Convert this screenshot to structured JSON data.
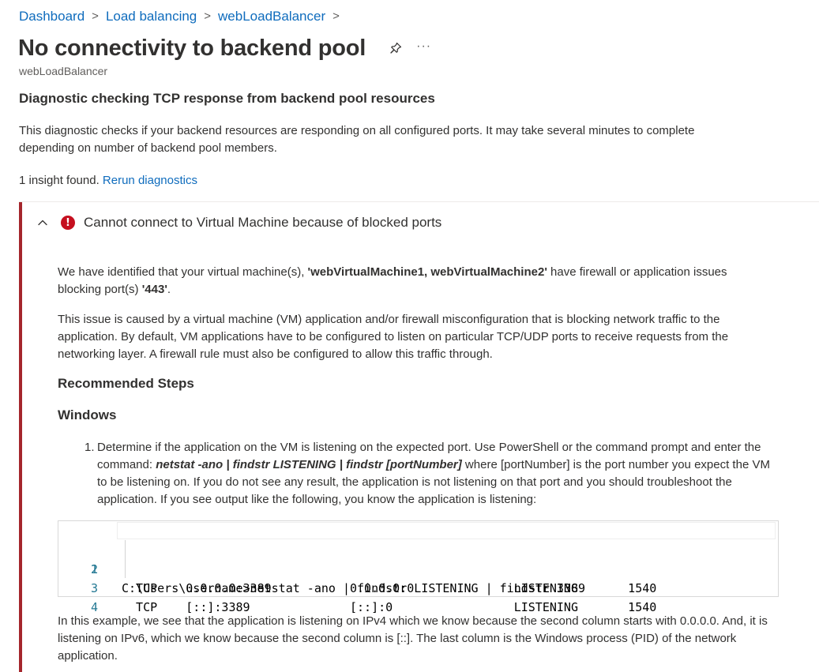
{
  "breadcrumb": {
    "items": [
      "Dashboard",
      "Load balancing",
      "webLoadBalancer"
    ],
    "separator": ">"
  },
  "page": {
    "title": "No connectivity to backend pool",
    "subtitle": "webLoadBalancer",
    "more_label": "···"
  },
  "diagnostic": {
    "heading": "Diagnostic checking TCP response from backend pool resources",
    "description": "This diagnostic checks if your backend resources are responding on all configured ports. It may take several minutes to complete depending on number of backend pool members.",
    "insight_count_text": "1 insight found.",
    "rerun_link": "Rerun diagnostics"
  },
  "insight": {
    "title": "Cannot connect to Virtual Machine because of blocked ports",
    "p1_a": "We have identified that your virtual machine(s), ",
    "p1_vms": "'webVirtualMachine1, webVirtualMachine2'",
    "p1_b": " have firewall or application issues blocking port(s) ",
    "p1_port": "'443'",
    "p1_c": ".",
    "p2": "This issue is caused by a virtual machine (VM) application and/or firewall misconfiguration that is blocking network traffic to the application. By default, VM applications have to be configured to listen on particular TCP/UDP ports to receive requests from the networking layer. A firewall rule must also be configured to allow this traffic through.",
    "recommended_heading": "Recommended Steps",
    "windows_heading": "Windows",
    "step1_num": "1.",
    "step1_a": "Determine if the application on the VM is listening on the expected port. Use PowerShell or the command prompt and enter the command: ",
    "step1_cmd": "netstat -ano | findstr LISTENING | findstr [portNumber]",
    "step1_b": " where [portNumber] is the port number you expect the VM to be listening on. If you do not see any result, the application is not listening on that port and you should troubleshoot the application. If you see output like the following, you know the application is listening:",
    "code_lines": [
      {
        "ln": "1",
        "text": "C:\\Users\\username>netstat -ano | findstr LISTENING | findstr 3389"
      },
      {
        "ln": "2",
        "text": "  TCP    0.0.0.0:3389           0.0.0.0:0              LISTENING       1540"
      },
      {
        "ln": "3",
        "text": "  TCP    [::]:3389              [::]:0                 LISTENING       1540"
      },
      {
        "ln": "4",
        "text": ""
      }
    ],
    "p3": "In this example, we see that the application is listening on IPv4 which we know because the second column starts with 0.0.0.0. And, it is listening on IPv6, which we know because the second column is [::]. The last column is the Windows process (PID) of the network application."
  },
  "colors": {
    "link": "#0f6cbd",
    "error": "#c50f1f",
    "insight_border": "#a4262c",
    "line_number": "#237893"
  },
  "icons": {
    "pin": "pin-icon",
    "more": "more-icon",
    "chevron": "chevron-up-icon",
    "error": "error-icon"
  }
}
